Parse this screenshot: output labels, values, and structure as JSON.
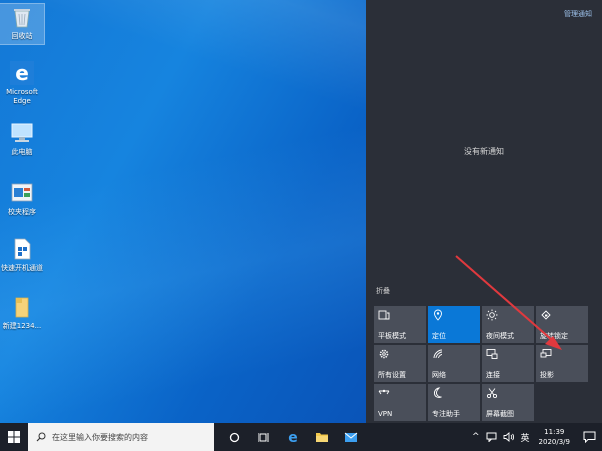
{
  "desktop": {
    "icons": [
      {
        "label": "回收站",
        "icon": "recycle-bin-icon"
      },
      {
        "label": "Microsoft Edge",
        "icon": "edge-icon"
      },
      {
        "label": "此电脑",
        "icon": "this-pc-icon"
      },
      {
        "label": "校夹程序",
        "icon": "program-icon"
      },
      {
        "label": "快速开机通道",
        "icon": "file-icon"
      },
      {
        "label": "新建1234...",
        "icon": "folder-icon"
      }
    ]
  },
  "action_center": {
    "manage_notifications": "管理通知",
    "no_new_notifications": "没有新通知",
    "collapse": "折叠",
    "tiles": [
      {
        "label": "平板模式",
        "icon": "tablet-mode-icon",
        "active": false
      },
      {
        "label": "定位",
        "icon": "location-icon",
        "active": true
      },
      {
        "label": "夜间模式",
        "icon": "night-light-icon",
        "active": false
      },
      {
        "label": "旋转锁定",
        "icon": "rotation-lock-icon",
        "active": false
      },
      {
        "label": "所有设置",
        "icon": "settings-icon",
        "active": false
      },
      {
        "label": "网络",
        "icon": "network-icon",
        "active": false
      },
      {
        "label": "连接",
        "icon": "connect-icon",
        "active": false
      },
      {
        "label": "投影",
        "icon": "project-icon",
        "active": false
      },
      {
        "label": "VPN",
        "icon": "vpn-icon",
        "active": false
      },
      {
        "label": "专注助手",
        "icon": "focus-assist-icon",
        "active": false
      },
      {
        "label": "屏幕截图",
        "icon": "screen-snip-icon",
        "active": false
      }
    ]
  },
  "taskbar": {
    "search_placeholder": "在这里输入你要搜索的内容",
    "tray": {
      "chevron": "^",
      "input_language": "英"
    },
    "clock": {
      "time": "11:39",
      "date": "2020/3/9"
    }
  },
  "colors": {
    "accent": "#0a78d7",
    "annotation_arrow": "#e0393e"
  }
}
